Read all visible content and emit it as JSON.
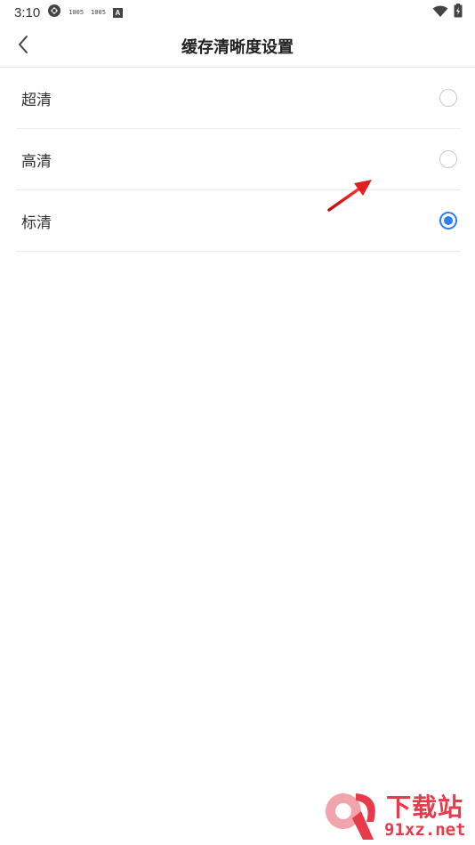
{
  "status_bar": {
    "time": "3:10",
    "tiny_label_1": "1005",
    "tiny_label_2": "1005",
    "a_badge": "A"
  },
  "header": {
    "title": "缓存清晰度设置",
    "back_icon": "chevron-left-icon"
  },
  "options": [
    {
      "label": "超清",
      "selected": false
    },
    {
      "label": "高清",
      "selected": false
    },
    {
      "label": "标清",
      "selected": true
    }
  ],
  "colors": {
    "accent": "#2f7fea",
    "annotation_arrow": "#e02020",
    "watermark": "#e83a4a"
  },
  "watermark": {
    "brand": "下载站",
    "url": "91xz.net",
    "logo_mark": "9"
  }
}
